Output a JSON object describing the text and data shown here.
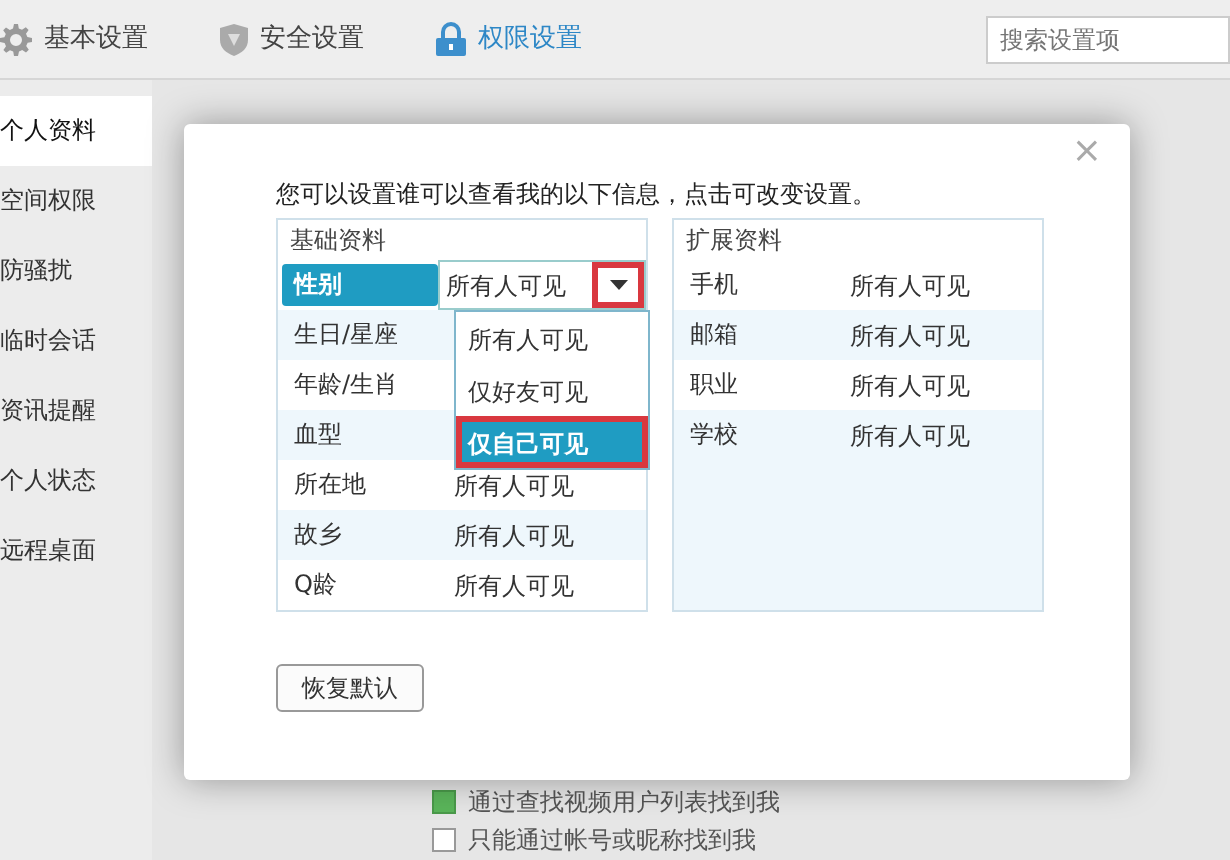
{
  "topbar": {
    "tabs": [
      {
        "label": "基本设置",
        "selected": false
      },
      {
        "label": "安全设置",
        "selected": false
      },
      {
        "label": "权限设置",
        "selected": true
      }
    ],
    "search": {
      "placeholder": "搜索设置项"
    }
  },
  "sidebar": {
    "items": [
      {
        "label": "个人资料",
        "selected": true
      },
      {
        "label": "空间权限",
        "selected": false
      },
      {
        "label": "防骚扰",
        "selected": false
      },
      {
        "label": "临时会话",
        "selected": false
      },
      {
        "label": "资讯提醒",
        "selected": false
      },
      {
        "label": "个人状态",
        "selected": false
      },
      {
        "label": "远程桌面",
        "selected": false
      }
    ]
  },
  "options": [
    {
      "label": "通过查找视频用户列表找到我",
      "checked": true
    },
    {
      "label": "只能通过帐号或昵称找到我",
      "checked": false
    }
  ],
  "dialog": {
    "close": "×",
    "intro": "您可以设置谁可以查看我的以下信息，点击可改变设置。",
    "basic": {
      "title": "基础资料",
      "rows": [
        {
          "label": "性别",
          "value": "所有人可见",
          "selected": true
        },
        {
          "label": "生日/星座",
          "selected": false
        },
        {
          "label": "年龄/生肖",
          "selected": false
        },
        {
          "label": "血型",
          "selected": false
        },
        {
          "label": "所在地",
          "value": "所有人可见",
          "selected": false
        },
        {
          "label": "故乡",
          "value": "所有人可见",
          "selected": false
        },
        {
          "label": "Q龄",
          "value": "所有人可见",
          "selected": false
        }
      ]
    },
    "dropdown": {
      "expanded": true,
      "highlighted": true,
      "options": [
        {
          "label": "所有人可见",
          "selected": false,
          "highlighted": false
        },
        {
          "label": "仅好友可见",
          "selected": false,
          "highlighted": false
        },
        {
          "label": "仅自己可见",
          "selected": true,
          "highlighted": true
        }
      ]
    },
    "extended": {
      "title": "扩展资料",
      "rows": [
        {
          "label": "手机",
          "value": "所有人可见"
        },
        {
          "label": "邮箱",
          "value": "所有人可见"
        },
        {
          "label": "职业",
          "value": "所有人可见"
        },
        {
          "label": "学校",
          "value": "所有人可见"
        }
      ]
    },
    "reset_button": "恢复默认"
  }
}
